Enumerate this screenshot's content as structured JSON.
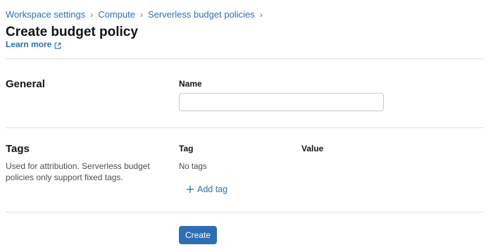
{
  "breadcrumb": {
    "items": [
      "Workspace settings",
      "Compute",
      "Serverless budget policies"
    ],
    "separator": "›"
  },
  "page": {
    "title": "Create budget policy",
    "learn_more": "Learn more"
  },
  "general": {
    "title": "General",
    "name_label": "Name",
    "name_value": "",
    "name_placeholder": ""
  },
  "tags": {
    "title": "Tags",
    "description": "Used for attribution. Serverless budget policies only support fixed tags.",
    "column_tag": "Tag",
    "column_value": "Value",
    "empty_text": "No tags",
    "add_tag_label": "Add tag"
  },
  "actions": {
    "create_label": "Create"
  },
  "colors": {
    "link": "#2e6fb0",
    "primary_button": "#2f6db3",
    "divider": "#dfe2e5"
  },
  "icons": {
    "learn_more": "external-link-icon",
    "add_tag": "plus-icon"
  }
}
